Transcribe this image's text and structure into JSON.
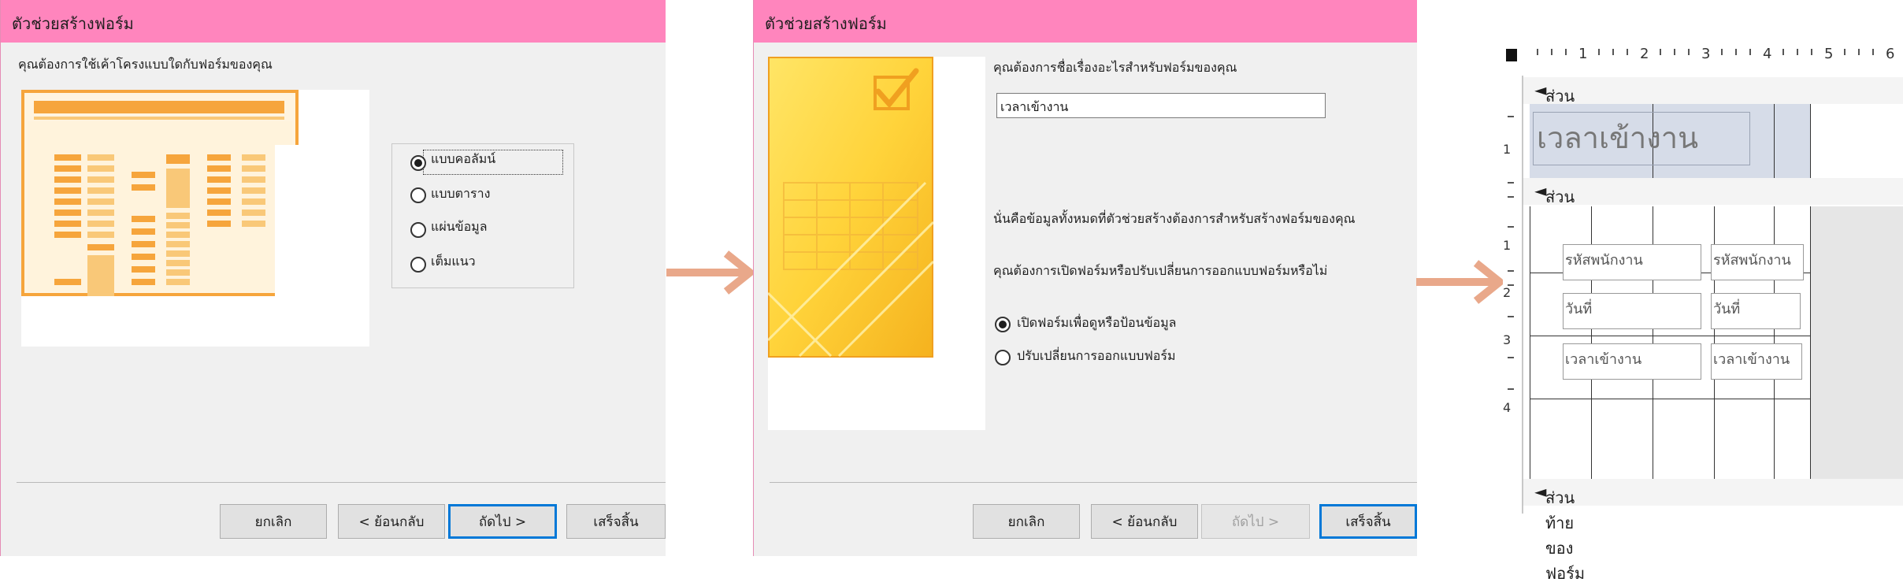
{
  "dialog1": {
    "title": "ตัวช่วยสร้างฟอร์ม",
    "prompt": "คุณต้องการใช้เค้าโครงแบบใดกับฟอร์มของคุณ",
    "layouts": [
      {
        "label": "แบบคอลัมน์",
        "selected": true
      },
      {
        "label": "แบบตาราง",
        "selected": false
      },
      {
        "label": "แผ่นข้อมูล",
        "selected": false
      },
      {
        "label": "เต็มแนว",
        "selected": false
      }
    ],
    "buttons": {
      "cancel": "ยกเลิก",
      "back": "< ย้อนกลับ",
      "next": "ถัดไป >",
      "finish": "เสร็จสิ้น"
    }
  },
  "dialog2": {
    "title": "ตัวช่วยสร้างฟอร์ม",
    "title_prompt": "คุณต้องการชื่อเรื่องอะไรสำหรับฟอร์มของคุณ",
    "title_value": "เวลาเข้างาน",
    "info": "นั่นคือข้อมูลทั้งหมดที่ตัวช่วยสร้างต้องการสำหรับสร้างฟอร์มของคุณ",
    "open_prompt": "คุณต้องการเปิดฟอร์มหรือปรับเปลี่ยนการออกแบบฟอร์มหรือไม่",
    "options": [
      {
        "label": "เปิดฟอร์มเพื่อดูหรือป้อนข้อมูล",
        "selected": true
      },
      {
        "label": "ปรับเปลี่ยนการออกแบบฟอร์ม",
        "selected": false
      }
    ],
    "buttons": {
      "cancel": "ยกเลิก",
      "back": "< ย้อนกลับ",
      "next": "ถัดไป >",
      "finish": "เสร็จสิ้น"
    }
  },
  "design": {
    "ruler_numbers": [
      "1",
      "2",
      "3",
      "4",
      "5",
      "6"
    ],
    "left_ruler_numbers": [
      "1",
      "1",
      "2",
      "3",
      "4"
    ],
    "header_section": "ส่วนหัวของฟอร์ม",
    "form_title": "เวลาเข้างาน",
    "detail_section": "ส่วนรายละเอียด",
    "fields": [
      {
        "label": "รหัสพนักงาน",
        "control": "รหัสพนักงาน"
      },
      {
        "label": "วันที่",
        "control": "วันที่"
      },
      {
        "label": "เวลาเข้างาน",
        "control": "เวลาเข้างาน"
      }
    ],
    "footer_section": "ส่วนท้ายของฟอร์ม"
  },
  "colors": {
    "titlebar": "#ff85bd",
    "arrow": "#e9a88a",
    "accent_orange": "#f6a53c",
    "focus_blue": "#0078d7"
  }
}
